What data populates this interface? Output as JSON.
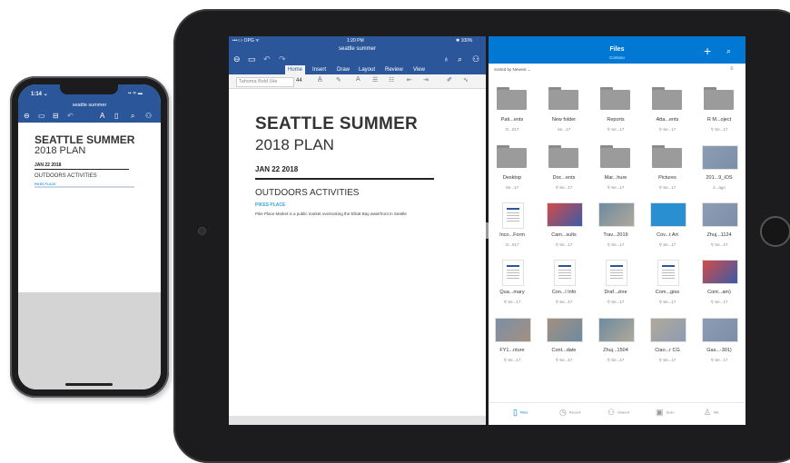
{
  "colors": {
    "word_blue": "#2b579a",
    "onedrive_blue": "#0078d4",
    "pikes_blue": "#3aa3d8",
    "folder_gray": "#9b9b9b"
  },
  "ipad": {
    "status": {
      "carrier": "•••○○ OPG ᯤ",
      "time": "1:20 PM",
      "battery": "✱ 100%"
    },
    "word": {
      "doc_title": "seattle summer",
      "toolbar_icons": [
        "back-icon",
        "file-icon",
        "undo-icon",
        "redo-icon",
        "lightbulb-icon",
        "search-icon",
        "share-icon"
      ],
      "tabs": [
        "Home",
        "Insert",
        "Draw",
        "Layout",
        "Review",
        "View"
      ],
      "active_tab": "Home",
      "font_name": "Tahoma Bold (He",
      "font_size": "44",
      "document": {
        "title": "SEATTLE SUMMER",
        "subtitle": "2018 PLAN",
        "date": "JAN 22 2018",
        "section": "OUTDOORS ACTIVITIES",
        "pikes_heading": "PIKES PLACE",
        "body": "Pike Place Market is a public market overlooking the Elliott Bay waterfront in Seattle"
      }
    },
    "files": {
      "title": "Files",
      "subtitle": "Contoso",
      "sort_label": "Sorted by Newest ⌄",
      "items": [
        {
          "name": "Pati...ents",
          "meta": "O...017",
          "kind": "folder"
        },
        {
          "name": "New folder",
          "meta": "Se...17",
          "kind": "folder"
        },
        {
          "name": "Reports",
          "meta": "⚲ Se...17",
          "kind": "folder"
        },
        {
          "name": "Atta...ents",
          "meta": "⚲ Se...17",
          "kind": "folder"
        },
        {
          "name": "R M...oject",
          "meta": "⚲ Se...17",
          "kind": "folder"
        },
        {
          "name": "Desktop",
          "meta": "Se...17",
          "kind": "folder"
        },
        {
          "name": "Doc...ents",
          "meta": "⚲ Se...17",
          "kind": "folder"
        },
        {
          "name": "Mar...hure",
          "meta": "⚲ Se...17",
          "kind": "folder"
        },
        {
          "name": "Pictures",
          "meta": "⚲ Se...17",
          "kind": "folder"
        },
        {
          "name": "201...9_iOS",
          "meta": "4...ago",
          "kind": "photo"
        },
        {
          "name": "Inco...Form",
          "meta": "O...017",
          "kind": "doc"
        },
        {
          "name": "Cam...sults",
          "meta": "⚲ Se...17",
          "kind": "slide"
        },
        {
          "name": "Trav...2019",
          "meta": "⚲ Se...17",
          "kind": "photo"
        },
        {
          "name": "Cov...t Art",
          "meta": "⚲ Se...17",
          "kind": "cover"
        },
        {
          "name": "Zhuj...1124",
          "meta": "⚲ Se...17",
          "kind": "photo"
        },
        {
          "name": "Qua...mary",
          "meta": "⚲ Se...17",
          "kind": "doc"
        },
        {
          "name": "Con...l Info",
          "meta": "⚲ Se...17",
          "kind": "doc"
        },
        {
          "name": "Draf...zine",
          "meta": "⚲ Se...17",
          "kind": "doc"
        },
        {
          "name": "Com...gies",
          "meta": "⚲ Se...17",
          "kind": "doc"
        },
        {
          "name": "Cont...am)",
          "meta": "⚲ Se...17",
          "kind": "slide"
        },
        {
          "name": "FY1...nture",
          "meta": "⚲ Se...17",
          "kind": "photo"
        },
        {
          "name": "Cont...date",
          "meta": "⚲ Se...17",
          "kind": "photo"
        },
        {
          "name": "Zhuj...1504",
          "meta": "⚲ Se...17",
          "kind": "photo"
        },
        {
          "name": "Ciao...r CG",
          "meta": "⚲ Se...17",
          "kind": "photo"
        },
        {
          "name": "Gas...-301)",
          "meta": "⚲ Se...17",
          "kind": "photo"
        }
      ],
      "tabbar": [
        {
          "label": "Files",
          "icon": "files-icon",
          "active": true
        },
        {
          "label": "Recent",
          "icon": "clock-icon",
          "active": false
        },
        {
          "label": "Shared",
          "icon": "people-icon",
          "active": false
        },
        {
          "label": "Scan",
          "icon": "scan-icon",
          "active": false
        },
        {
          "label": "Me",
          "icon": "person-icon",
          "active": false
        }
      ]
    }
  },
  "iphone": {
    "time": "1:14 ⌄",
    "signal": "▪▪ ᯤ ▬",
    "doc_title": "seattle summer",
    "document": {
      "title": "SEATTLE SUMMER",
      "subtitle": "2018 PLAN",
      "date": "JAN 22 2018",
      "section": "OUTDOORS ACTIVITIES",
      "pikes_heading": "PIKES PLACE"
    }
  }
}
